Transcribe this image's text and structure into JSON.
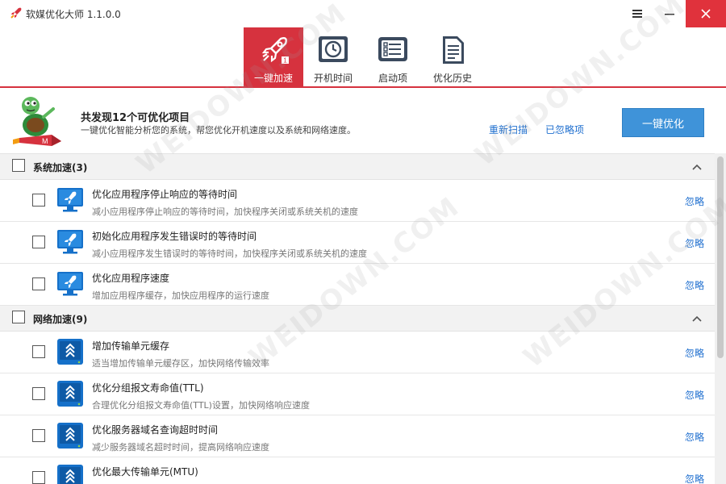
{
  "app": {
    "title": "软媒优化大师 1.1.0.0",
    "logo_icon": "rocket-icon"
  },
  "titlebar": {
    "menu_icon": "hamburger-menu-icon",
    "minimize_icon": "minimize-icon",
    "close_icon": "close-icon",
    "close_color": "#e0323c"
  },
  "tabs": [
    {
      "label": "一键加速",
      "icon": "rocket-icon",
      "active": true
    },
    {
      "label": "开机时间",
      "icon": "clock-icon",
      "active": false
    },
    {
      "label": "启动项",
      "icon": "checklist-icon",
      "active": false
    },
    {
      "label": "优化历史",
      "icon": "document-icon",
      "active": false
    }
  ],
  "accent_color": "#d6323e",
  "summary": {
    "title": "共发现12个可优化项目",
    "description": "一键优化智能分析您的系统，帮您优化开机速度以及系统和网络速度。",
    "rescan_label": "重新扫描",
    "ignored_label": "已忽略项",
    "optimize_button": "一键优化",
    "mascot_icon": "turtle-rocket-mascot-icon"
  },
  "ignore_label": "忽略",
  "groups": [
    {
      "title": "系统加速(3)",
      "items": [
        {
          "title": "优化应用程序停止响应的等待时间",
          "desc": "减小应用程序停止响应的等待时间，加快程序关闭或系统关机的速度",
          "icon": "monitor-rocket-icon"
        },
        {
          "title": "初始化应用程序发生错误时的等待时间",
          "desc": "减小应用程序发生错误时的等待时间，加快程序关闭或系统关机的速度",
          "icon": "monitor-rocket-icon"
        },
        {
          "title": "优化应用程序速度",
          "desc": "增加应用程序缓存，加快应用程序的运行速度",
          "icon": "monitor-rocket-icon"
        }
      ]
    },
    {
      "title": "网络加速(9)",
      "items": [
        {
          "title": "增加传输单元缓存",
          "desc": "适当增加传输单元缓存区，加快网络传输效率",
          "icon": "network-drive-icon"
        },
        {
          "title": "优化分组报文寿命值(TTL)",
          "desc": "合理优化分组报文寿命值(TTL)设置，加快网络响应速度",
          "icon": "network-drive-icon"
        },
        {
          "title": "优化服务器域名查询超时时间",
          "desc": "减少服务器域名超时时间，提高网络响应速度",
          "icon": "network-drive-icon"
        },
        {
          "title": "优化最大传输单元(MTU)",
          "desc": "",
          "icon": "network-drive-icon"
        }
      ]
    }
  ],
  "watermark": "WEIDOWN.COM"
}
